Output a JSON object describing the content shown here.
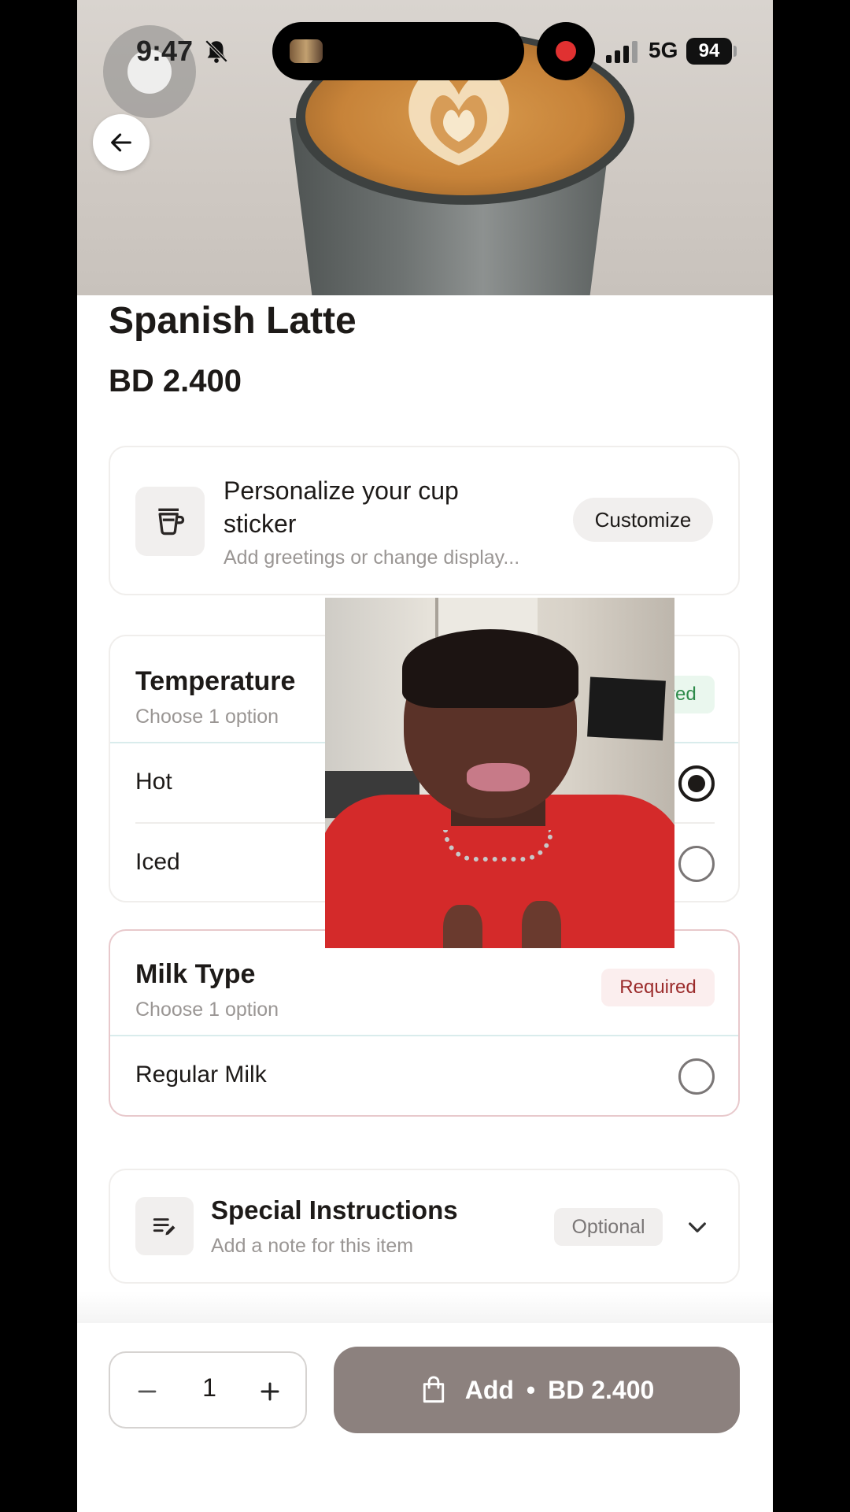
{
  "status_bar": {
    "time": "9:47",
    "network": "5G",
    "battery": "94"
  },
  "product": {
    "title": "Spanish Latte",
    "price": "BD 2.400"
  },
  "sticker_card": {
    "title": "Personalize your cup sticker",
    "subtitle": "Add greetings or change display...",
    "button": "Customize"
  },
  "temperature": {
    "title": "Temperature",
    "subtitle": "Choose 1 option",
    "badge": "Required",
    "options": [
      {
        "label": "Hot",
        "selected": true
      },
      {
        "label": "Iced",
        "selected": false
      }
    ]
  },
  "milk": {
    "title": "Milk Type",
    "subtitle": "Choose 1 option",
    "badge": "Required",
    "options": [
      {
        "label": "Regular Milk",
        "selected": false
      }
    ]
  },
  "special": {
    "title": "Special Instructions",
    "subtitle": "Add a note for this item",
    "badge": "Optional"
  },
  "cart": {
    "quantity": "1",
    "add_label": "Add",
    "separator": "•",
    "add_price": "BD 2.400"
  },
  "colors": {
    "required_green": "#2e8b4a",
    "required_red": "#9b2b2b",
    "add_button": "#8c817e",
    "record": "#e03131"
  },
  "icons": [
    "bell-muted-icon",
    "signal-icon",
    "arrow-left-icon",
    "cup-icon",
    "note-edit-icon",
    "chevron-down-icon",
    "minus-icon",
    "plus-icon",
    "shopping-bag-icon"
  ]
}
